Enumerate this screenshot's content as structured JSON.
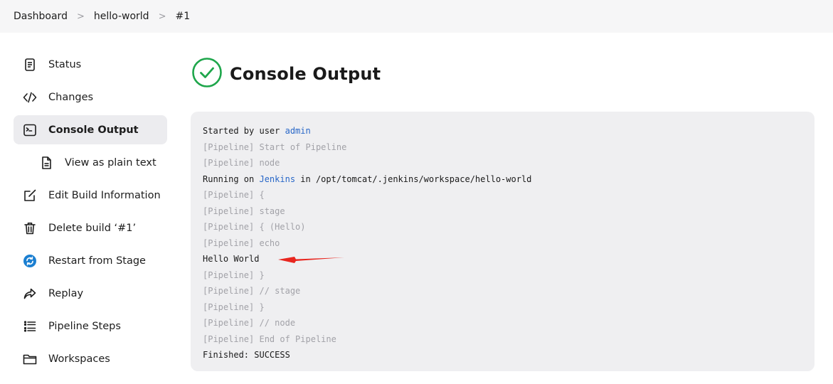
{
  "breadcrumb": {
    "items": [
      "Dashboard",
      "hello-world",
      "#1"
    ],
    "separator": ">"
  },
  "sidebar": {
    "items": [
      {
        "label": "Status",
        "icon": "document-icon"
      },
      {
        "label": "Changes",
        "icon": "code-icon"
      },
      {
        "label": "Console Output",
        "icon": "terminal-icon",
        "active": true
      },
      {
        "label": "View as plain text",
        "icon": "file-icon",
        "sub": true
      },
      {
        "label": "Edit Build Information",
        "icon": "edit-icon"
      },
      {
        "label": "Delete build ‘#1’",
        "icon": "trash-icon"
      },
      {
        "label": "Restart from Stage",
        "icon": "restart-icon"
      },
      {
        "label": "Replay",
        "icon": "replay-icon"
      },
      {
        "label": "Pipeline Steps",
        "icon": "steps-icon"
      },
      {
        "label": "Workspaces",
        "icon": "folder-icon"
      }
    ]
  },
  "main": {
    "title": "Console Output",
    "status_icon": "success-check-icon",
    "status_color": "#1ea64b"
  },
  "console": {
    "line0_prefix": "Started by user ",
    "line0_link": "admin",
    "line1": "[Pipeline] Start of Pipeline",
    "line2": "[Pipeline] node",
    "line3_prefix": "Running on ",
    "line3_link": "Jenkins",
    "line3_suffix": " in /opt/tomcat/.jenkins/workspace/hello-world",
    "line4": "[Pipeline] {",
    "line5": "[Pipeline] stage",
    "line6": "[Pipeline] { (Hello)",
    "line7": "[Pipeline] echo",
    "line8": "Hello World",
    "line9": "[Pipeline] }",
    "line10": "[Pipeline] // stage",
    "line11": "[Pipeline] }",
    "line12": "[Pipeline] // node",
    "line13": "[Pipeline] End of Pipeline",
    "line14": "Finished: SUCCESS"
  },
  "colors": {
    "link": "#2867c8",
    "annotation_arrow": "#e8261f",
    "restart_icon": "#1b7fd1"
  }
}
